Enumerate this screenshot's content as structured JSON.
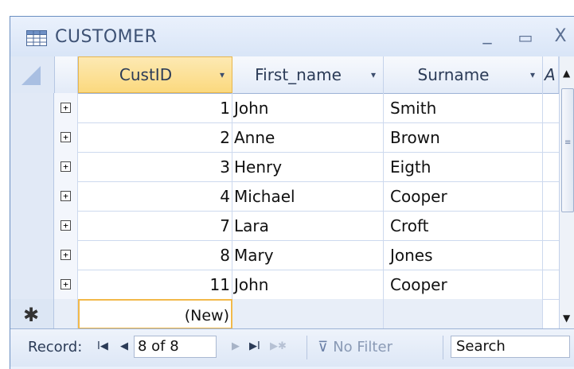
{
  "window": {
    "title": "CUSTOMER",
    "minimize_glyph": "_",
    "maximize_glyph": "▭",
    "close_glyph": "X"
  },
  "columns": {
    "custid": "CustID",
    "first_name": "First_name",
    "surname": "Surname",
    "partial": "A",
    "sort_arrow": "▾"
  },
  "rows": [
    {
      "id": "1",
      "first": "John",
      "surname": "Smith"
    },
    {
      "id": "2",
      "first": "Anne",
      "surname": "Brown"
    },
    {
      "id": "3",
      "first": "Henry",
      "surname": "Eigth"
    },
    {
      "id": "4",
      "first": "Michael",
      "surname": "Cooper"
    },
    {
      "id": "7",
      "first": "Lara",
      "surname": "Croft"
    },
    {
      "id": "8",
      "first": "Mary",
      "surname": "Jones"
    },
    {
      "id": "11",
      "first": "John",
      "surname": "Cooper"
    }
  ],
  "new_row": {
    "marker": "✱",
    "id_placeholder": "(New)"
  },
  "expand_glyph": "+",
  "navbar": {
    "record_label": "Record:",
    "first_glyph": "I◀",
    "prev_glyph": "◀",
    "position": "8 of 8",
    "next_glyph": "▶",
    "last_glyph": "▶I",
    "new_glyph": "▶✱",
    "filter_icon": "filter-icon",
    "filter_label": "No Filter",
    "search_label": "Search"
  },
  "colors": {
    "active_header": "#fbd97e",
    "selector": "#e1e9f6",
    "title_text": "#3e5275"
  }
}
